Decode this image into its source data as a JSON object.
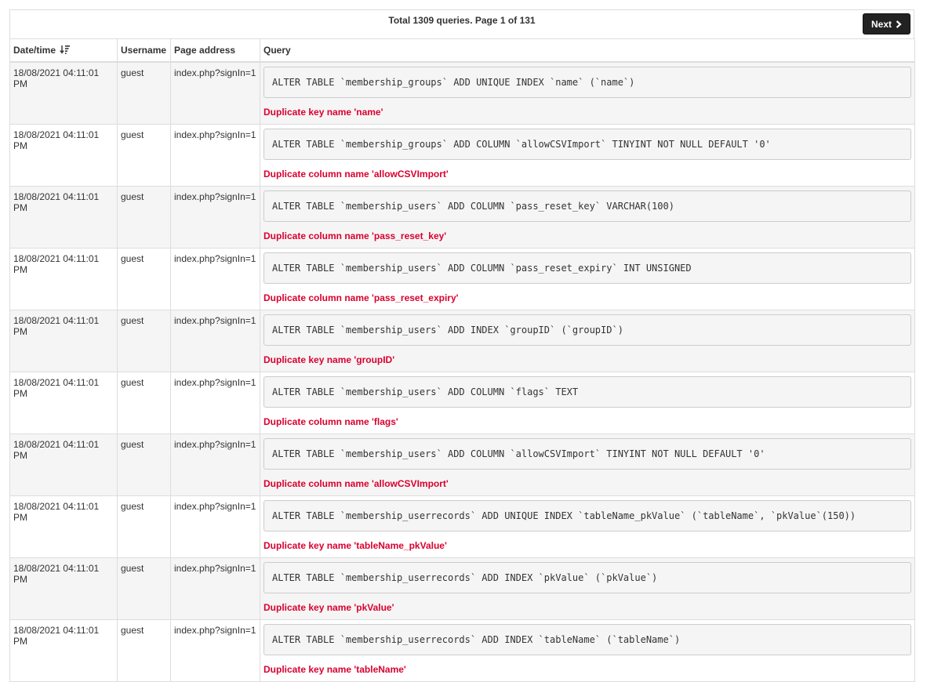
{
  "pager": {
    "info": "Total 1309 queries. Page 1 of 131",
    "next_label": "Next"
  },
  "columns": {
    "datetime": "Date/time",
    "username": "Username",
    "page": "Page address",
    "query": "Query"
  },
  "rows": [
    {
      "datetime": "18/08/2021 04:11:01 PM",
      "username": "guest",
      "page": "index.php?signIn=1",
      "query": "ALTER TABLE `membership_groups` ADD UNIQUE INDEX `name` (`name`)",
      "error": "Duplicate key name 'name'"
    },
    {
      "datetime": "18/08/2021 04:11:01 PM",
      "username": "guest",
      "page": "index.php?signIn=1",
      "query": "ALTER TABLE `membership_groups` ADD COLUMN `allowCSVImport` TINYINT NOT NULL DEFAULT '0'",
      "error": "Duplicate column name 'allowCSVImport'"
    },
    {
      "datetime": "18/08/2021 04:11:01 PM",
      "username": "guest",
      "page": "index.php?signIn=1",
      "query": "ALTER TABLE `membership_users` ADD COLUMN `pass_reset_key` VARCHAR(100)",
      "error": "Duplicate column name 'pass_reset_key'"
    },
    {
      "datetime": "18/08/2021 04:11:01 PM",
      "username": "guest",
      "page": "index.php?signIn=1",
      "query": "ALTER TABLE `membership_users` ADD COLUMN `pass_reset_expiry` INT UNSIGNED",
      "error": "Duplicate column name 'pass_reset_expiry'"
    },
    {
      "datetime": "18/08/2021 04:11:01 PM",
      "username": "guest",
      "page": "index.php?signIn=1",
      "query": "ALTER TABLE `membership_users` ADD INDEX `groupID` (`groupID`)",
      "error": "Duplicate key name 'groupID'"
    },
    {
      "datetime": "18/08/2021 04:11:01 PM",
      "username": "guest",
      "page": "index.php?signIn=1",
      "query": "ALTER TABLE `membership_users` ADD COLUMN `flags` TEXT",
      "error": "Duplicate column name 'flags'"
    },
    {
      "datetime": "18/08/2021 04:11:01 PM",
      "username": "guest",
      "page": "index.php?signIn=1",
      "query": "ALTER TABLE `membership_users` ADD COLUMN `allowCSVImport` TINYINT NOT NULL DEFAULT '0'",
      "error": "Duplicate column name 'allowCSVImport'"
    },
    {
      "datetime": "18/08/2021 04:11:01 PM",
      "username": "guest",
      "page": "index.php?signIn=1",
      "query": "ALTER TABLE `membership_userrecords` ADD UNIQUE INDEX `tableName_pkValue` (`tableName`, `pkValue`(150))",
      "error": "Duplicate key name 'tableName_pkValue'"
    },
    {
      "datetime": "18/08/2021 04:11:01 PM",
      "username": "guest",
      "page": "index.php?signIn=1",
      "query": "ALTER TABLE `membership_userrecords` ADD INDEX `pkValue` (`pkValue`)",
      "error": "Duplicate key name 'pkValue'"
    },
    {
      "datetime": "18/08/2021 04:11:01 PM",
      "username": "guest",
      "page": "index.php?signIn=1",
      "query": "ALTER TABLE `membership_userrecords` ADD INDEX `tableName` (`tableName`)",
      "error": "Duplicate key name 'tableName'"
    }
  ],
  "icons": {
    "sort": "sort-descending-icon",
    "next": "chevron-right-icon"
  },
  "colors": {
    "error": "#d9002f",
    "button": "#222222",
    "stripe": "#f5f5f5"
  }
}
